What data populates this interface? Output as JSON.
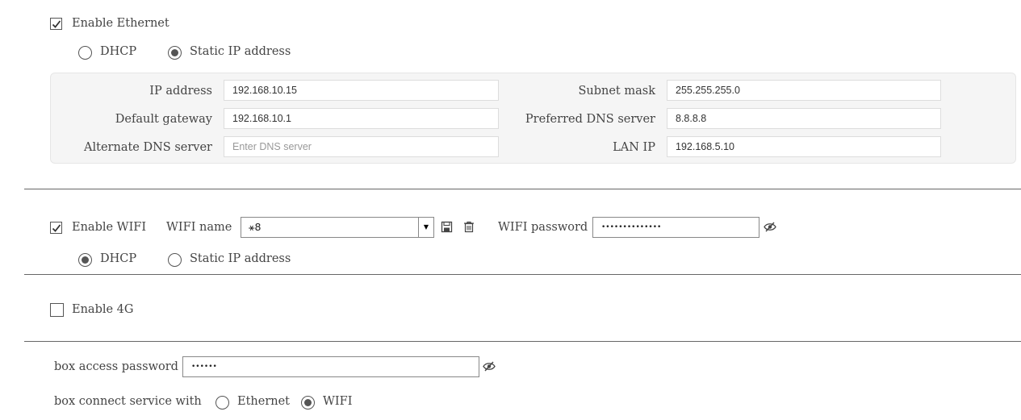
{
  "ethernet": {
    "enable_label": "Enable Ethernet",
    "enabled": true,
    "mode_dhcp_label": "DHCP",
    "mode_static_label": "Static IP address",
    "selected_mode": "static",
    "fields": {
      "ip_address_label": "IP address",
      "ip_address_value": "192.168.10.15",
      "subnet_mask_label": "Subnet mask",
      "subnet_mask_value": "255.255.255.0",
      "default_gateway_label": "Default gateway",
      "default_gateway_value": "192.168.10.1",
      "preferred_dns_label": "Preferred DNS server",
      "preferred_dns_value": "8.8.8.8",
      "alternate_dns_label": "Alternate DNS server",
      "alternate_dns_placeholder": "Enter DNS server",
      "lan_ip_label": "LAN IP",
      "lan_ip_value": "192.168.5.10"
    }
  },
  "wifi": {
    "enable_label": "Enable WIFI",
    "enabled": true,
    "name_label": "WIFI name",
    "name_value": "⚹8",
    "password_label": "WIFI password",
    "password_value": "••••••••••••••",
    "mode_dhcp_label": "DHCP",
    "mode_static_label": "Static IP address",
    "selected_mode": "dhcp",
    "icons": [
      "save-icon",
      "trash-icon",
      "eye-slash-icon"
    ]
  },
  "lte": {
    "enable_label": "Enable 4G",
    "enabled": false
  },
  "box": {
    "password_label": "box access password",
    "password_value": "••••••",
    "connect_label": "box connect service with",
    "option_ethernet_label": "Ethernet",
    "option_wifi_label": "WIFI",
    "selected_option": "wifi"
  },
  "colors": {
    "panel_bg": "#f5f5f5",
    "border": "#555555",
    "divider": "#666666"
  }
}
